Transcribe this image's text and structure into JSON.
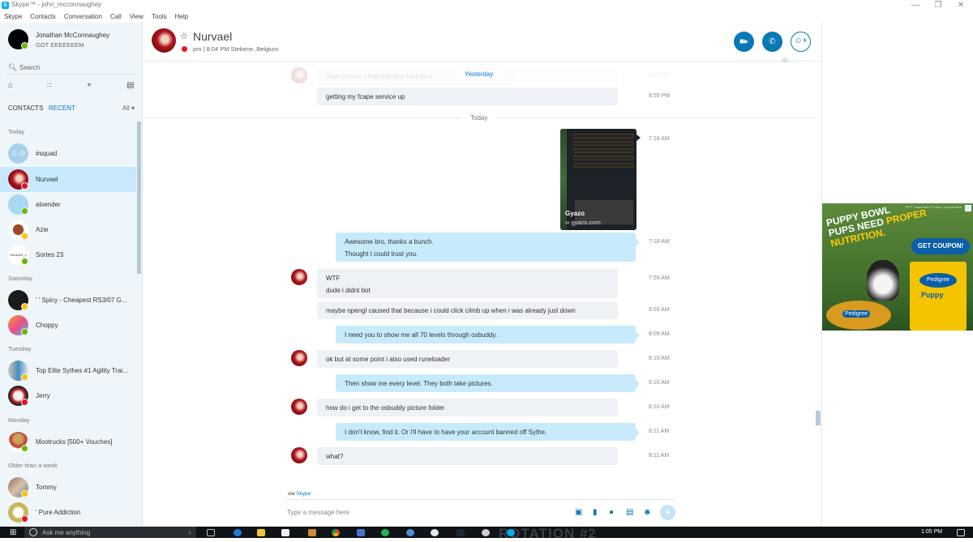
{
  "window": {
    "title": "Skype™ - john_mcconnaughey",
    "controls": {
      "minimize": "—",
      "maximize": "❐",
      "close": "✕"
    }
  },
  "menu": [
    "Skype",
    "Contacts",
    "Conversation",
    "Call",
    "View",
    "Tools",
    "Help"
  ],
  "profile": {
    "name": "Jonathan McConnaughey",
    "mood": "GOT EEEEEEEM",
    "status": "online"
  },
  "search": {
    "placeholder": "Search",
    "icon": "search-icon"
  },
  "nav_icons": [
    "home-icon",
    "dialpad-icon",
    "add-icon",
    "new-chat-icon"
  ],
  "tabs": {
    "contacts": "CONTACTS",
    "recent": "RECENT",
    "filter": "All ▾"
  },
  "recent_groups": [
    {
      "label": "Today",
      "items": [
        {
          "name": "#squad",
          "status": "none",
          "avatar": "group-avatar"
        },
        {
          "name": "Nurvael",
          "status": "busy",
          "active": true
        },
        {
          "name": "alxender",
          "status": "online"
        },
        {
          "name": "Azie",
          "status": "away"
        },
        {
          "name": "Sortes 23",
          "status": "online",
          "avatar_text": "Sortes23_1"
        }
      ]
    },
    {
      "label": "Saturday",
      "items": [
        {
          "name": "' ' Spicy - Cheapest RS3/07 G...",
          "status": "away"
        },
        {
          "name": "Choppy",
          "status": "online"
        }
      ]
    },
    {
      "label": "Tuesday",
      "items": [
        {
          "name": "Top Elite Sythes #1 Agility Trai...",
          "status": "away"
        },
        {
          "name": "Jerry",
          "status": "busy"
        }
      ]
    },
    {
      "label": "Monday",
      "items": [
        {
          "name": "Mootrucks [500+ Vouches]",
          "status": "online"
        }
      ]
    },
    {
      "label": "Older than a week",
      "items": [
        {
          "name": "Tommy",
          "status": "away"
        },
        {
          "name": "' Pure Addiction",
          "status": "busy"
        }
      ]
    }
  ],
  "conversation": {
    "name": "Nurvael",
    "subtitle": "pm  |  8:04 PM Stekene, Belgium",
    "status": "busy",
    "buttons": {
      "video": "video-call-button",
      "call": "audio-call-button",
      "add": "add-participant-button"
    }
  },
  "messages": {
    "faded_top": {
      "text": "Yeah lol now I feel way less bad for u",
      "time": "8:27 PM"
    },
    "separator_yesterday": "Yesterday",
    "m1": {
      "text": "getting my fcape service up",
      "time": "8:55 PM",
      "from": "them"
    },
    "separator_today": "Today",
    "image_card": {
      "title": "Gyazo",
      "link": "gyazo.com",
      "time": "7:18 AM",
      "from": "me"
    },
    "m2": {
      "lines": [
        "Awesome bro, thanks a bunch.",
        "Thought I could trust you."
      ],
      "time": "7:18 AM",
      "from": "me"
    },
    "m3": {
      "lines": [
        "WTF",
        "dude i didnt bot"
      ],
      "time": "7:59 AM",
      "from": "them"
    },
    "m4": {
      "text": "maybe opengl caused that because i could click cilmb up when i was already just down",
      "time": "8:03 AM",
      "from": "them"
    },
    "m5": {
      "text": "I need you to show me all 70 levels through osbuddy.",
      "time": "8:09 AM",
      "from": "me"
    },
    "m6": {
      "text": "ok but at some point i also used runeloader",
      "time": "8:10 AM",
      "from": "them"
    },
    "m7": {
      "text": "Then show me every level. They both take pictures.",
      "time": "8:10 AM",
      "from": "me"
    },
    "m8": {
      "text": "how do i get to the osbuddy picture folder",
      "time": "8:10 AM",
      "from": "them"
    },
    "m9": {
      "text": "I don't know, find it. Or I'll have to have your account banned off Sythe.",
      "time": "8:11 AM",
      "from": "me"
    },
    "m10": {
      "text": "what?",
      "time": "8:11 AM",
      "from": "them"
    }
  },
  "composer": {
    "via": "via",
    "via_link": "Skype",
    "placeholder": "Type a message here",
    "icons": [
      "send-photo-icon",
      "send-file-icon",
      "video-message-icon",
      "send-contact-icon",
      "emoticon-icon"
    ],
    "send": "send-icon"
  },
  "ad": {
    "trademark": "®/™ Trademarks © Mars, Incorporated",
    "headline_1": "PUPPY BOWL",
    "headline_2": "PUPS NEED",
    "headline_3": "PROPER",
    "headline_4": "NUTRITION.",
    "cta": "GET COUPON!",
    "brand": "Pedigree",
    "product": "Puppy"
  },
  "taskbar": {
    "search_placeholder": "Ask me anything",
    "wallpaper_text": "ROTATION #2",
    "clock": "1:05 PM",
    "apps": [
      "task-view",
      "edge",
      "file-explorer",
      "store",
      "photos",
      "chrome",
      "calculator",
      "spotify",
      "app",
      "app",
      "steam",
      "app",
      "skype"
    ]
  }
}
